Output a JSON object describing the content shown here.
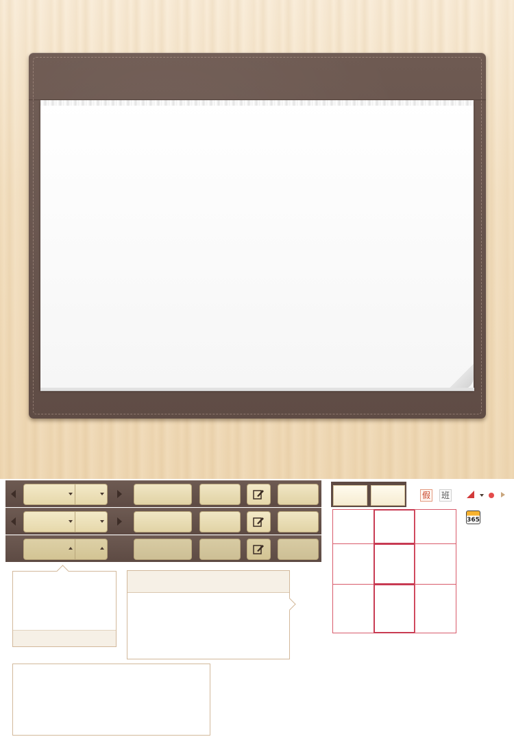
{
  "colors": {
    "wood_background": "#f3e0c2",
    "leather": "#5f4c45",
    "paper": "#ffffff",
    "button_fill": "#e6d8aa",
    "popup_border": "#d2b89a",
    "grid_red": "#d85a6a",
    "holiday_red": "#c8452a"
  },
  "toolbar": {
    "rows": [
      {
        "prev_icon": "left-arrow-icon",
        "next_icon": "right-arrow-icon",
        "caret": "down"
      },
      {
        "prev_icon": "left-arrow-icon",
        "next_icon": "right-arrow-icon",
        "caret": "down"
      },
      {
        "caret": "up"
      }
    ],
    "edit_icon": "edit-note-icon"
  },
  "markers": {
    "holiday_label": "假",
    "work_label": "班",
    "app_badge": "365"
  }
}
